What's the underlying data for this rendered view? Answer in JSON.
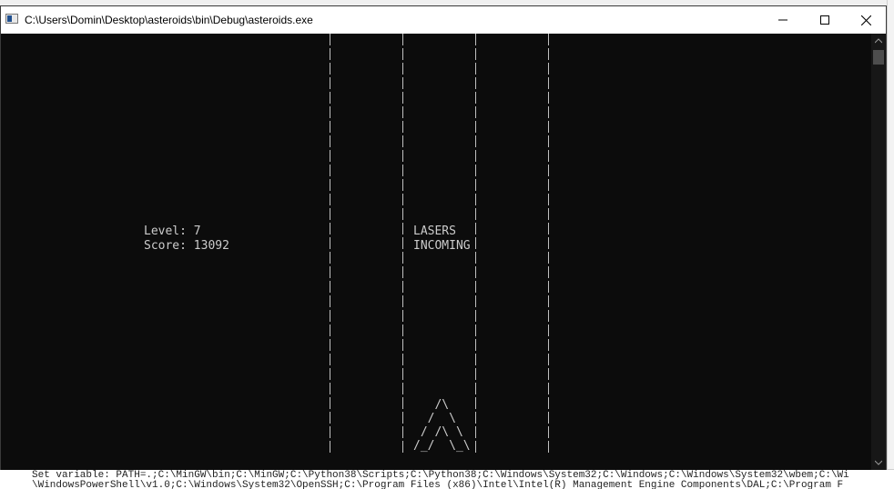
{
  "window": {
    "title": "C:\\Users\\Domin\\Desktop\\asteroids\\bin\\Debug\\asteroids.exe",
    "controls": {
      "minimize_icon": "minimize-icon",
      "maximize_icon": "maximize-icon",
      "close_icon": "close-icon"
    }
  },
  "game": {
    "level_text": "Level: 7",
    "score_text": "Score: 13092",
    "message_line1": "LASERS",
    "message_line2": "INCOMING",
    "ship_art": "   /\\\n  /  \\\n / /\\ \\\n/_/  \\_\\"
  },
  "background_cmd": {
    "line1": "Set variable: PATH=.;C:\\MinGW\\bin;C:\\MinGW;C:\\Python38\\Scripts;C:\\Python38;C:\\Windows\\System32;C:\\Windows;C:\\Windows\\System32\\wbem;C:\\Wi",
    "line2": "\\WindowsPowerShell\\v1.0;C:\\Windows\\System32\\OpenSSH;C:\\Program Files (x86)\\Intel\\Intel(R) Management Engine Components\\DAL;C:\\Program F"
  },
  "colors": {
    "console_bg": "#0c0c0c",
    "console_text": "#cccccc",
    "titlebar_bg": "#ffffff"
  }
}
